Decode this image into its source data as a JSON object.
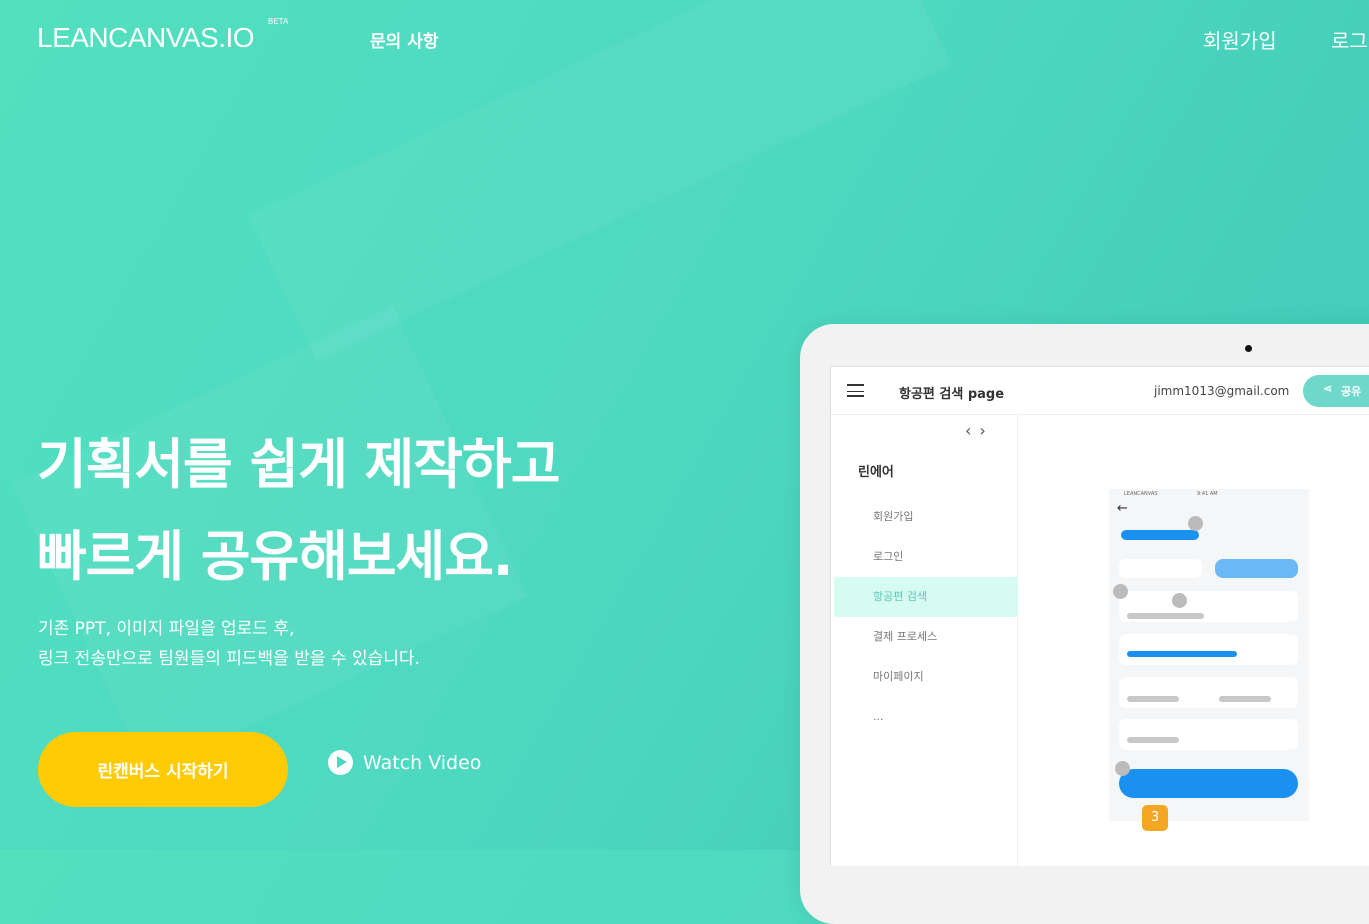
{
  "header": {
    "logo": "LEANCANVAS.IO",
    "beta": "BETA",
    "nav_inquiry": "문의 사항",
    "signup": "회원가입",
    "login": "로그"
  },
  "hero": {
    "title_line1": "기획서를 쉽게 제작하고",
    "title_line2": "빠르게 공유해보세요.",
    "sub_line1": "기존 PPT, 이미지 파일을 업로드 후,",
    "sub_line2": "링크 전송만으로 팀원들의 피드백을 받을 수 있습니다.",
    "cta": "린캔버스 시작하기",
    "watch": "Watch Video"
  },
  "mock": {
    "page_title": "항공편 검색 page",
    "email": "jimm1013@gmail.com",
    "share": "공유",
    "project": "린에어",
    "items": [
      "회원가입",
      "로그인",
      "항공편 검색",
      "결제 프로세스",
      "마이페이지",
      "..."
    ],
    "status_carrier": "LEANCANVAS",
    "status_time": "9:41 AM",
    "badge": "3"
  },
  "colors": {
    "accent": "#4dd8c0",
    "cta": "#ffcb05",
    "blue": "#1a90f0"
  }
}
